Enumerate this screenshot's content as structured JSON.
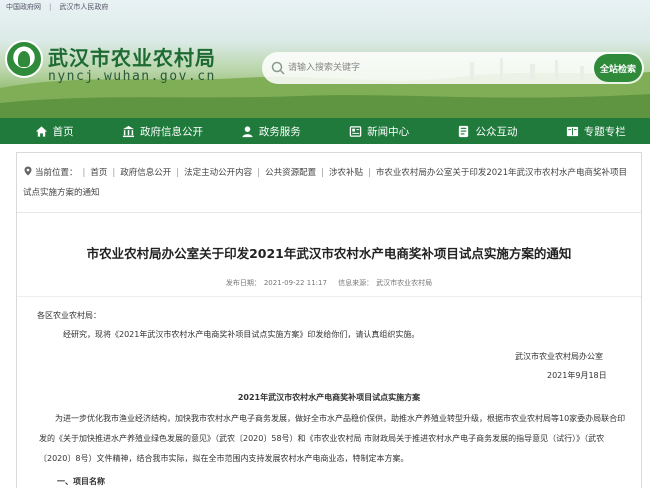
{
  "top_links": [
    "中国政府网",
    "武汉市人民政府"
  ],
  "site": {
    "title": "武汉市农业农村局",
    "domain": "nyncj.wuhan.gov.cn"
  },
  "search": {
    "placeholder": "请输入搜索关键字",
    "button_label": "全站检索"
  },
  "nav": [
    {
      "label": "首页",
      "icon": "home-icon"
    },
    {
      "label": "政府信息公开",
      "icon": "bank-icon"
    },
    {
      "label": "政务服务",
      "icon": "user-icon"
    },
    {
      "label": "新闻中心",
      "icon": "news-icon"
    },
    {
      "label": "公众互动",
      "icon": "chat-icon"
    },
    {
      "label": "专题专栏",
      "icon": "columns-icon"
    }
  ],
  "breadcrumb": {
    "prefix": "当前位置：",
    "items": [
      "首页",
      "政府信息公开",
      "法定主动公开内容",
      "公共资源配置",
      "涉农补贴",
      "市农业农村局办公室关于印发2021年武汉市农村水产电商奖补项目试点实施方案的通知"
    ]
  },
  "article": {
    "title": "市农业农村局办公室关于印发2021年武汉市农村水产电商奖补项目试点实施方案的通知",
    "publish_label": "发布日期：",
    "publish_date": "2021-09-22 11:17",
    "source_label": "信息来源：",
    "source": "武汉市农业农村局",
    "salutation": "各区农业农村局：",
    "intro": "经研究，现将《2021年武汉市农村水产电商奖补项目试点实施方案》印发给你们，请认真组织实施。",
    "signer": "武汉市农业农村局办公室",
    "sign_date": "2021年9月18日",
    "plan_title": "2021年武汉市农村水产电商奖补项目试点实施方案",
    "paragraph": "为进一步优化我市渔业经济结构，加快我市农村水产电子商务发展，做好全市水产品稳价保供，助推水产养殖业转型升级，根据市农业农村局等10家委办局联合印发的《关于加快推进水产养殖业绿色发展的意见》（武农〔2020〕58号）和《市农业农村局 市财政局关于推进农村水产电子商务发展的指导意见（试行）》（武农〔2020〕8号）文件精神，结合我市实际，拟在全市范围内支持发展农村水产电商业态，特制定本方案。",
    "section1": "一、项目名称"
  },
  "colors": {
    "nav_green": "#1f7a3c",
    "brand_green": "#2f8a3a"
  }
}
